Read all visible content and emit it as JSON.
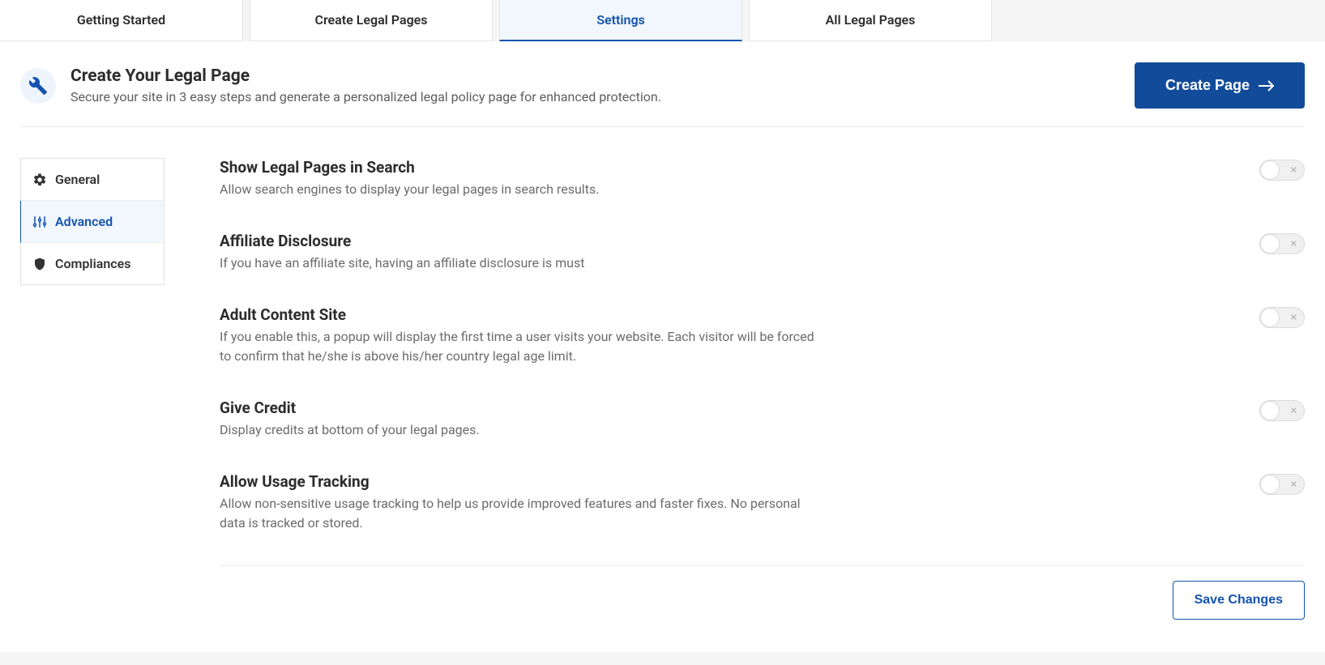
{
  "tabs": [
    {
      "label": "Getting Started",
      "active": false
    },
    {
      "label": "Create Legal Pages",
      "active": false
    },
    {
      "label": "Settings",
      "active": true
    },
    {
      "label": "All Legal Pages",
      "active": false
    }
  ],
  "header": {
    "title": "Create Your Legal Page",
    "subtitle": "Secure your site in 3 easy steps and generate a personalized legal policy page for enhanced protection.",
    "button_label": "Create Page"
  },
  "sidebar": [
    {
      "icon": "gear-icon",
      "label": "General",
      "active": false
    },
    {
      "icon": "sliders-icon",
      "label": "Advanced",
      "active": true
    },
    {
      "icon": "shield-icon",
      "label": "Compliances",
      "active": false
    }
  ],
  "settings": [
    {
      "title": "Show Legal Pages in Search",
      "desc": "Allow search engines to display your legal pages in search results.",
      "value": false
    },
    {
      "title": "Affiliate Disclosure",
      "desc": "If you have an affiliate site, having an affiliate disclosure is must",
      "value": false
    },
    {
      "title": "Adult Content Site",
      "desc": "If you enable this, a popup will display the first time a user visits your website. Each visitor will be forced to confirm that he/she is above his/her country legal age limit.",
      "value": false
    },
    {
      "title": "Give Credit",
      "desc": "Display credits at bottom of your legal pages.",
      "value": false
    },
    {
      "title": "Allow Usage Tracking",
      "desc": "Allow non-sensitive usage tracking to help us provide improved features and faster fixes. No personal data is tracked or stored.",
      "value": false
    }
  ],
  "save_label": "Save Changes"
}
